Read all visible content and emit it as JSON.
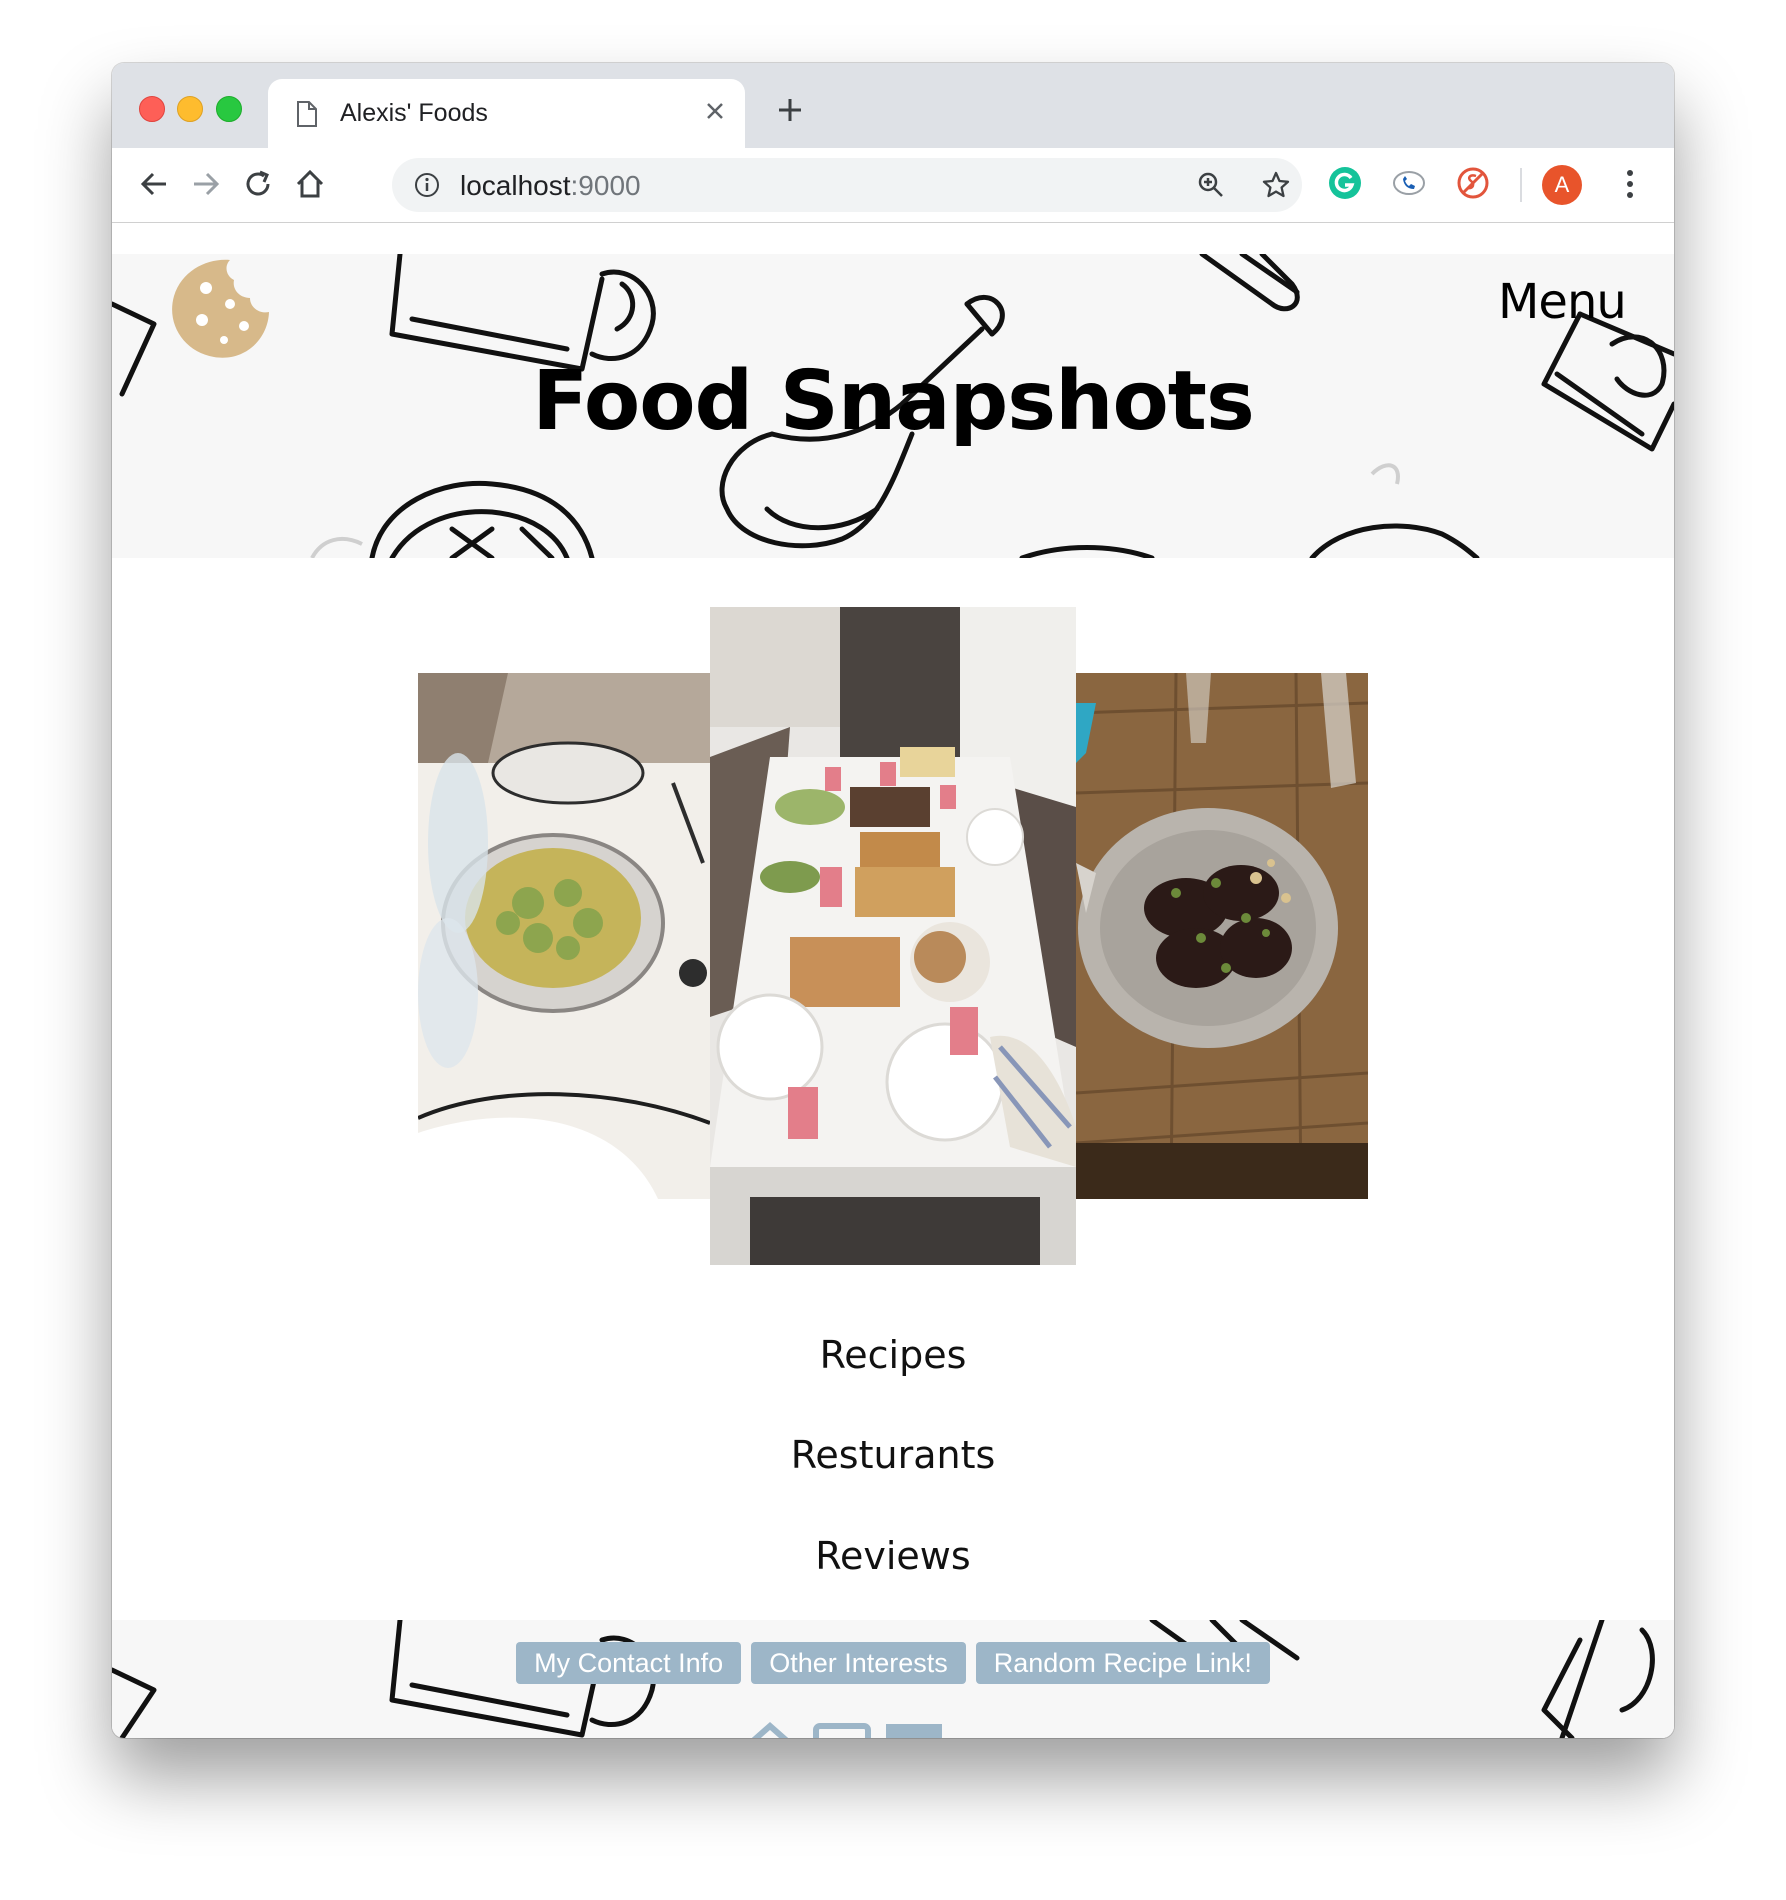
{
  "browser": {
    "tab": {
      "title": "Alexis' Foods"
    },
    "address": {
      "host": "localhost",
      "port": ":9000"
    },
    "profile_initial": "A"
  },
  "header": {
    "menu_label": "Menu",
    "title": "Food Snapshots"
  },
  "gallery": {
    "photos": [
      {
        "name": "pasta-dish-photo",
        "colors": [
          "#f2efea",
          "#b5a89a",
          "#8da54e",
          "#2d2d2d"
        ]
      },
      {
        "name": "dinner-table-photo",
        "colors": [
          "#e9e7e4",
          "#5a5350",
          "#c28a4a",
          "#e37e8a"
        ]
      },
      {
        "name": "eggplant-dish-photo",
        "colors": [
          "#8a6640",
          "#b9b4ad",
          "#2b1a17",
          "#6c8a3a"
        ]
      }
    ]
  },
  "nav": {
    "items": [
      "Recipes",
      "Resturants",
      "Reviews"
    ]
  },
  "footer": {
    "buttons": [
      "My Contact Info",
      "Other Interests",
      "Random Recipe Link!"
    ],
    "button_color": "#9db6c8"
  },
  "colors": {
    "cookie": "#d7b98a",
    "profile": "#e8542b",
    "tabstrip": "#dee1e6"
  }
}
